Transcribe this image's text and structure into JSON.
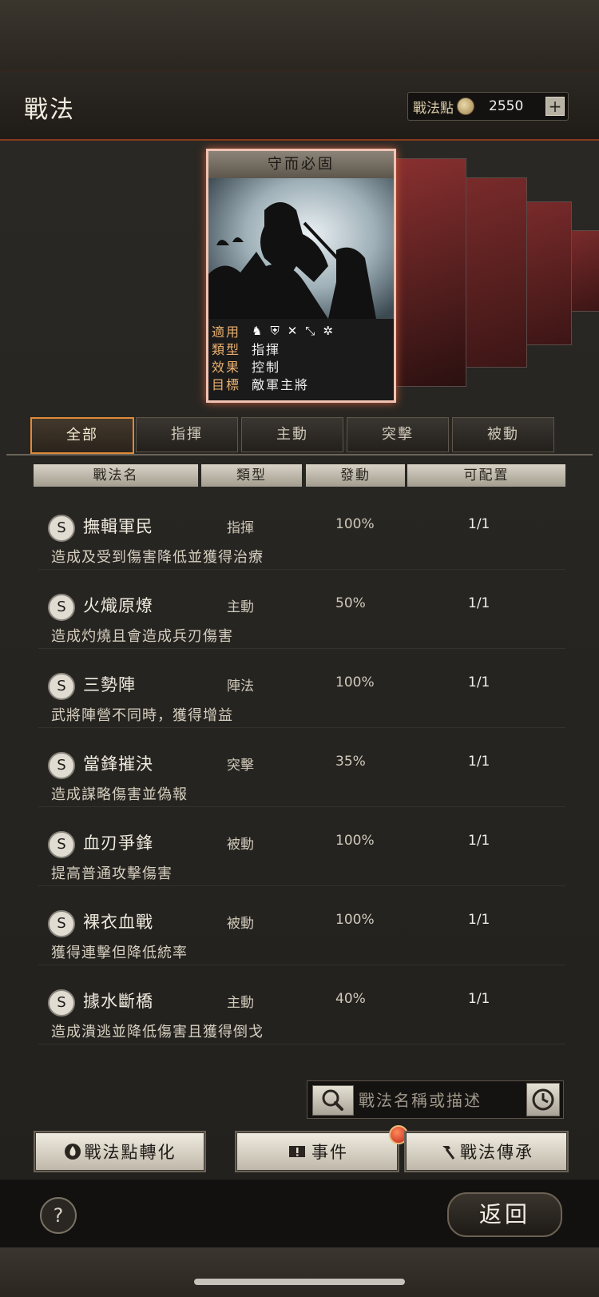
{
  "header": {
    "title": "戰法",
    "points_label": "戰法點",
    "points_value": "2550"
  },
  "card": {
    "name": "守而必固",
    "rows": [
      {
        "key": "適用",
        "value": ""
      },
      {
        "key": "類型",
        "value": "指揮"
      },
      {
        "key": "效果",
        "value": "控制"
      },
      {
        "key": "目標",
        "value": "敵軍主將"
      }
    ],
    "apply_icons": [
      "cavalry-icon",
      "shield-icon",
      "bow-icon",
      "spear-icon",
      "wheel-icon"
    ]
  },
  "tabs": [
    "全部",
    "指揮",
    "主動",
    "突擊",
    "被動"
  ],
  "columns": [
    "戰法名",
    "類型",
    "發動",
    "可配置"
  ],
  "rows": [
    {
      "grade": "S",
      "name": "撫輯軍民",
      "type": "指揮",
      "rate": "100%",
      "config": "1/1",
      "desc": "造成及受到傷害降低並獲得治療"
    },
    {
      "grade": "S",
      "name": "火熾原燎",
      "type": "主動",
      "rate": "50%",
      "config": "1/1",
      "desc": "造成灼燒且會造成兵刃傷害"
    },
    {
      "grade": "S",
      "name": "三勢陣",
      "type": "陣法",
      "rate": "100%",
      "config": "1/1",
      "desc": "武將陣營不同時，獲得增益"
    },
    {
      "grade": "S",
      "name": "當鋒摧決",
      "type": "突擊",
      "rate": "35%",
      "config": "1/1",
      "desc": "造成謀略傷害並偽報"
    },
    {
      "grade": "S",
      "name": "血刃爭鋒",
      "type": "被動",
      "rate": "100%",
      "config": "1/1",
      "desc": "提高普通攻擊傷害"
    },
    {
      "grade": "S",
      "name": "裸衣血戰",
      "type": "被動",
      "rate": "100%",
      "config": "1/1",
      "desc": "獲得連擊但降低統率"
    },
    {
      "grade": "S",
      "name": "據水斷橋",
      "type": "主動",
      "rate": "40%",
      "config": "1/1",
      "desc": "造成潰逃並降低傷害且獲得倒戈"
    }
  ],
  "search": {
    "placeholder": "戰法名稱或描述"
  },
  "actions": {
    "convert_label": "戰法點轉化",
    "event_label": "事件",
    "inherit_label": "戰法傳承"
  },
  "footer": {
    "help": "?",
    "back_label": "返回"
  },
  "colors": {
    "accent": "#e08a3a",
    "card_border": "#f2c3b3",
    "header_glow": "#8a3a1c"
  }
}
